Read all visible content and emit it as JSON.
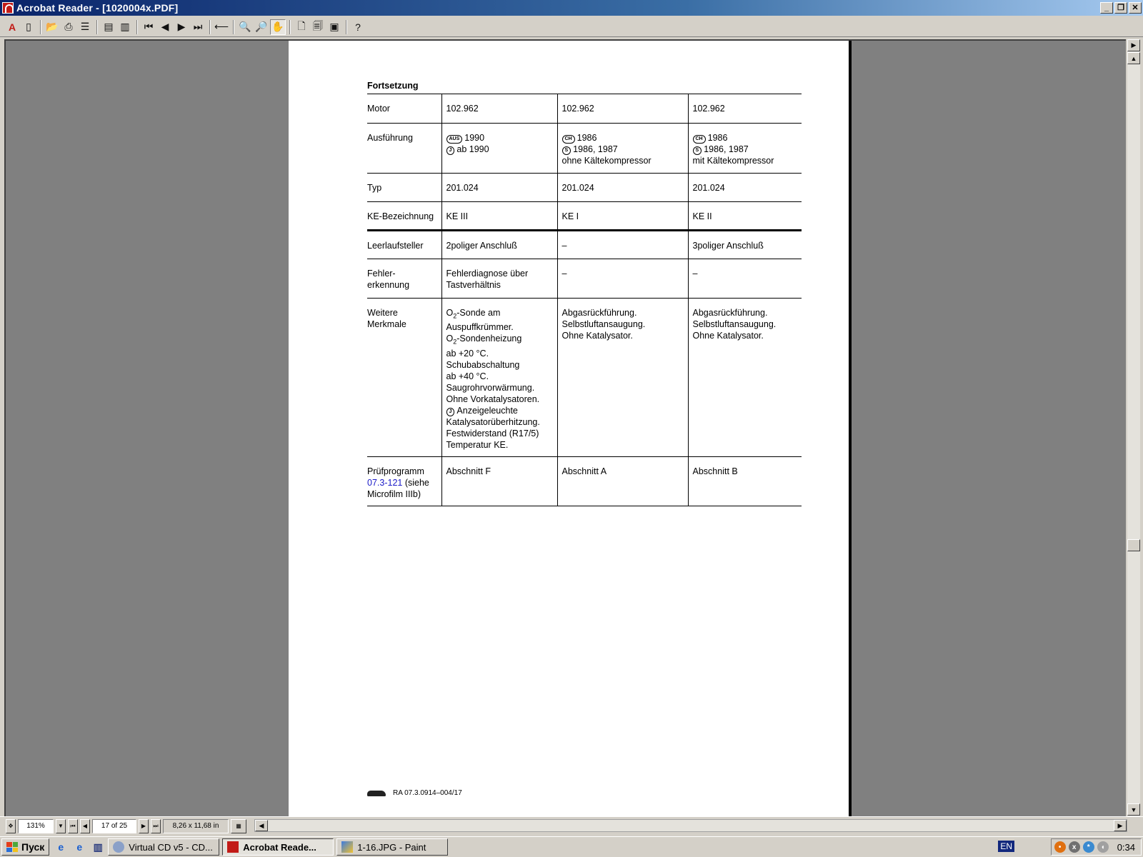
{
  "window": {
    "title": "Acrobat Reader - [1020004x.PDF]"
  },
  "titlebar_buttons": {
    "minimize": "_",
    "restore": "❐",
    "close": "✕"
  },
  "toolbar_icons": [
    "acrobat-icon",
    "bookmark-icon",
    "open-icon",
    "print-icon",
    "show-bookmarks-icon",
    "page-view-icon",
    "print-preview-icon",
    "first-page-icon",
    "prev-page-icon",
    "next-page-icon",
    "last-page-icon",
    "go-back-icon",
    "zoom-out-icon",
    "zoom-in-icon",
    "hand-tool-icon",
    "actual-size-icon",
    "fit-page-icon",
    "fit-width-icon",
    "help-icon"
  ],
  "document": {
    "section_heading": "Fortsetzung",
    "rows": [
      {
        "label": "Motor",
        "c1": "102.962",
        "c2": "102.962",
        "c3": "102.962"
      },
      {
        "label": "Ausführung",
        "c1": [
          {
            "badge": "AUS",
            "text": "1990"
          },
          {
            "badge": "J",
            "text": "ab 1990"
          }
        ],
        "c2": [
          {
            "badge": "CH",
            "text": "1986"
          },
          {
            "badge": "S",
            "text": "1986, 1987"
          },
          {
            "text": "ohne Kältekompressor"
          }
        ],
        "c3": [
          {
            "badge": "CH",
            "text": "1986"
          },
          {
            "badge": "S",
            "text": "1986, 1987"
          },
          {
            "text": "mit Kältekompressor"
          }
        ]
      },
      {
        "label": "Typ",
        "c1": "201.024",
        "c2": "201.024",
        "c3": "201.024"
      },
      {
        "label": "KE-Bezeichnung",
        "c1": "KE III",
        "c2": "KE I",
        "c3": "KE II"
      },
      {
        "label": "Leerlaufsteller",
        "c1": "2poliger Anschluß",
        "c2": "–",
        "c3": "3poliger Anschluß"
      },
      {
        "label": "Fehler- erkennung",
        "c1": "Fehlerdiagnose über Tastverhältnis",
        "c2": "–",
        "c3": "–"
      },
      {
        "label": "Weitere Merkmale",
        "c1": [
          "O2-Sonde am",
          "Auspuffkrümmer.",
          "O2-Sondenheizung",
          "ab +20 °C.",
          "Schubabschaltung",
          "ab +40 °C.",
          "Saugrohrvorwärmung.",
          "Ohne Vorkatalysatoren.",
          "J|Anzeigeleuchte",
          "Katalysatorüberhitzung.",
          "Festwiderstand (R17/5)",
          "Temperatur KE."
        ],
        "c2": [
          "Abgasrückführung.",
          "Selbstluftansaugung.",
          "Ohne Katalysator."
        ],
        "c3": [
          "Abgasrückführung.",
          "Selbstluftansaugung.",
          "Ohne Katalysator."
        ]
      },
      {
        "label_pre": "Prüfprogramm",
        "label_link": "07.3-121",
        "label_post": "(siehe Microfilm IIIb)",
        "c1": "Abschnitt F",
        "c2": "Abschnitt A",
        "c3": "Abschnitt B"
      }
    ],
    "footer_ref": "RA 07.3.0914–004/17"
  },
  "status": {
    "zoom": "131%",
    "page": "17 of 25",
    "page_size": "8,26 x 11,68 in"
  },
  "taskbar": {
    "start_label": "Пуск",
    "tasks": [
      {
        "label": "Virtual CD v5 - CD...",
        "active": false
      },
      {
        "label": "Acrobat Reade...",
        "active": true
      },
      {
        "label": "1-16.JPG - Paint",
        "active": false
      }
    ],
    "language": "EN",
    "clock": "0:34"
  },
  "colors": {
    "link": "#1a1ac8",
    "title_start": "#0a246a",
    "workspace": "#808080"
  }
}
